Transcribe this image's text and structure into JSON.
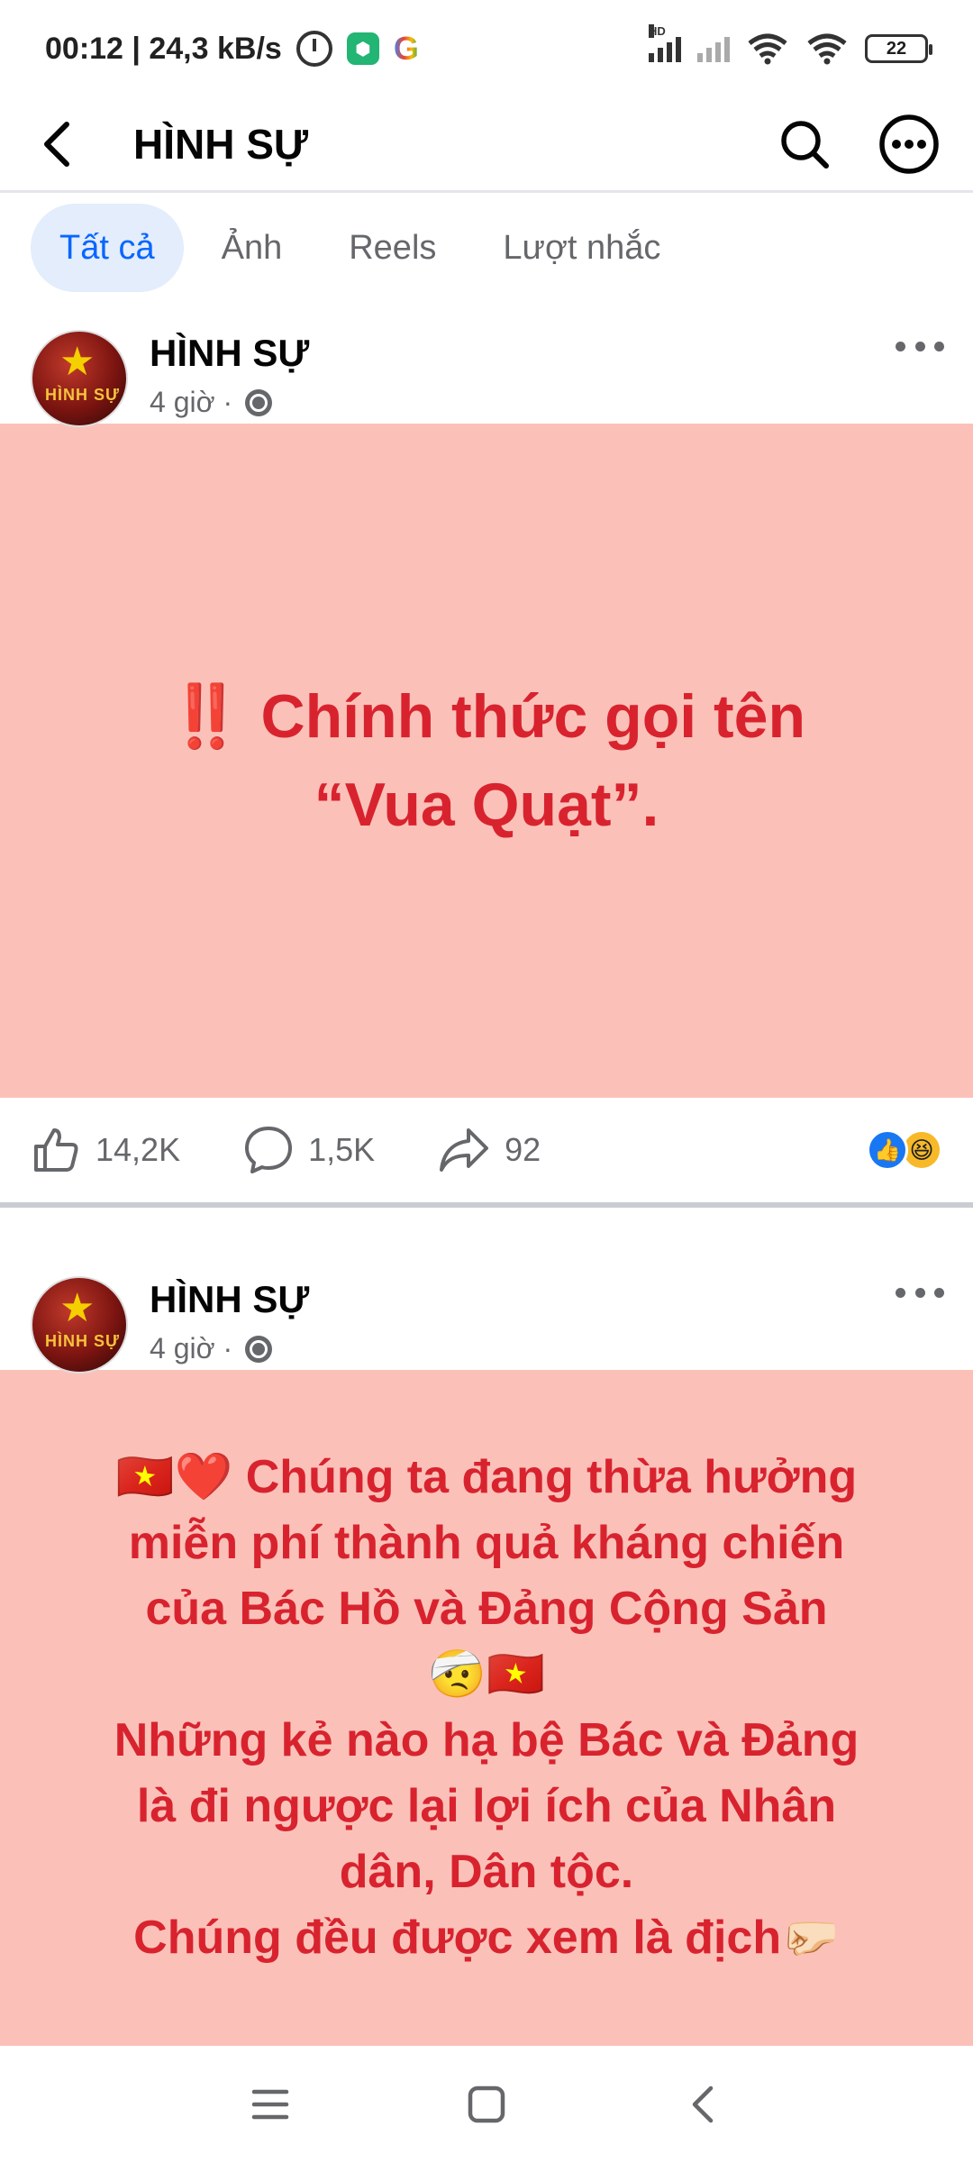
{
  "status_bar": {
    "time_speed": "00:12 | 24,3 kB/s",
    "hd_label": "HD",
    "battery": "22"
  },
  "header": {
    "title": "HÌNH SỰ"
  },
  "tabs": [
    {
      "label": "Tất cả",
      "active": true
    },
    {
      "label": "Ảnh",
      "active": false
    },
    {
      "label": "Reels",
      "active": false
    },
    {
      "label": "Lượt nhắc",
      "active": false
    }
  ],
  "posts": [
    {
      "author": "HÌNH SỰ",
      "time": "4 giờ ·",
      "avatar_text": "HÌNH SỰ",
      "text": "‼️ Chính thức gọi tên\n“Vua Quạt”.",
      "likes": "14,2K",
      "comments": "1,5K",
      "shares": "92"
    },
    {
      "author": "HÌNH SỰ",
      "time": "4 giờ ·",
      "avatar_text": "HÌNH SỰ",
      "text": "🇻🇳❤️ Chúng ta đang thừa hưởng\nmiễn phí thành quả kháng chiến\ncủa Bác Hồ và Đảng Cộng Sản\n🤕🇻🇳\nNhững kẻ nào hạ bệ Bác và Đảng\nlà đi ngược lại lợi ích của Nhân\ndân, Dân tộc.\nChúng đều được xem là địch🤛🏻"
    }
  ],
  "colors": {
    "post_bg": "#fbc1b9",
    "post_text": "#d8232f",
    "accent": "#0866ff"
  }
}
